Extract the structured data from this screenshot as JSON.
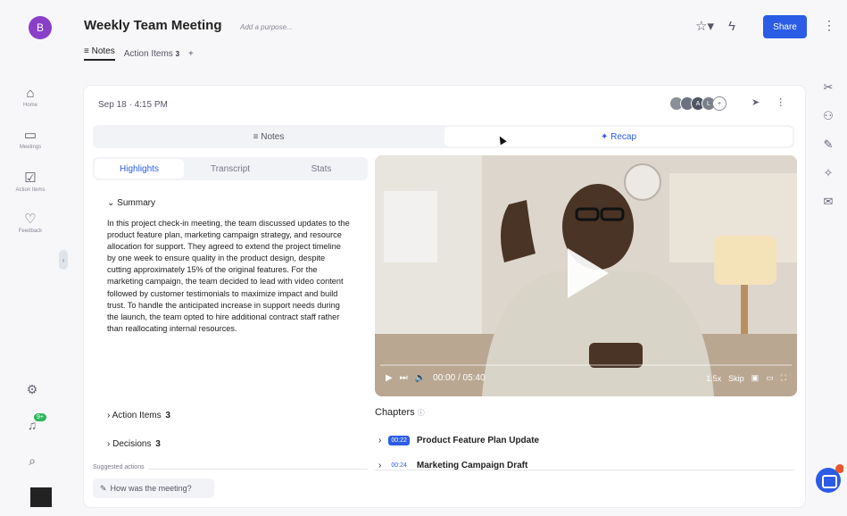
{
  "app": {
    "logo_letter": "B",
    "title": "Weekly Team Meeting",
    "purpose_placeholder": "Add a purpose...",
    "tabs": [
      {
        "label": "Notes",
        "icon": "lines-icon"
      },
      {
        "label": "Action Items",
        "count": "3"
      },
      {
        "label": "+"
      }
    ],
    "share_label": "Share",
    "colors": {
      "accent": "#2b5ce6",
      "logo": "#8a3fc9",
      "badge": "#2cb65a",
      "notify": "#e8562a"
    }
  },
  "rail": {
    "items": [
      {
        "label": "Home",
        "icon": "home-icon"
      },
      {
        "label": "Meetings",
        "icon": "calendar-icon"
      },
      {
        "label": "Action Items",
        "icon": "checkbox-icon"
      },
      {
        "label": "Feedback",
        "icon": "feedback-icon"
      }
    ],
    "bottom_badge": "9+"
  },
  "card": {
    "date": "Sep 18 · 4:15 PM",
    "avatars": [
      "A",
      "L"
    ],
    "switch": {
      "notes": "Notes",
      "recap": "Recap"
    },
    "panel_tabs": [
      "Highlights",
      "Transcript",
      "Stats"
    ],
    "summary_title": "Summary",
    "summary_text": "In this project check-in meeting, the team discussed updates to the product feature plan, marketing campaign strategy, and resource allocation for support. They agreed to extend the project timeline by one week to ensure quality in the product design, despite cutting approximately 15% of the original features. For the marketing campaign, the team decided to lead with video content followed by customer testimonials to maximize impact and build trust. To handle the anticipated increase in support needs during the launch, the team opted to hire additional contract staff rather than reallocating internal resources.",
    "action_items": {
      "label": "Action Items",
      "count": "3"
    },
    "decisions": {
      "label": "Decisions",
      "count": "3"
    },
    "suggested_label": "Suggested actions",
    "ask_label": "How was the meeting?"
  },
  "video": {
    "time": "00:00 / 05:40",
    "speed": "1.5x",
    "skip": "Skip",
    "progress": 0.0
  },
  "chapters": {
    "title": "Chapters",
    "items": [
      {
        "time": "00:22",
        "title": "Product Feature Plan Update"
      },
      {
        "time": "00:24",
        "title": "Marketing Campaign Draft"
      }
    ]
  }
}
